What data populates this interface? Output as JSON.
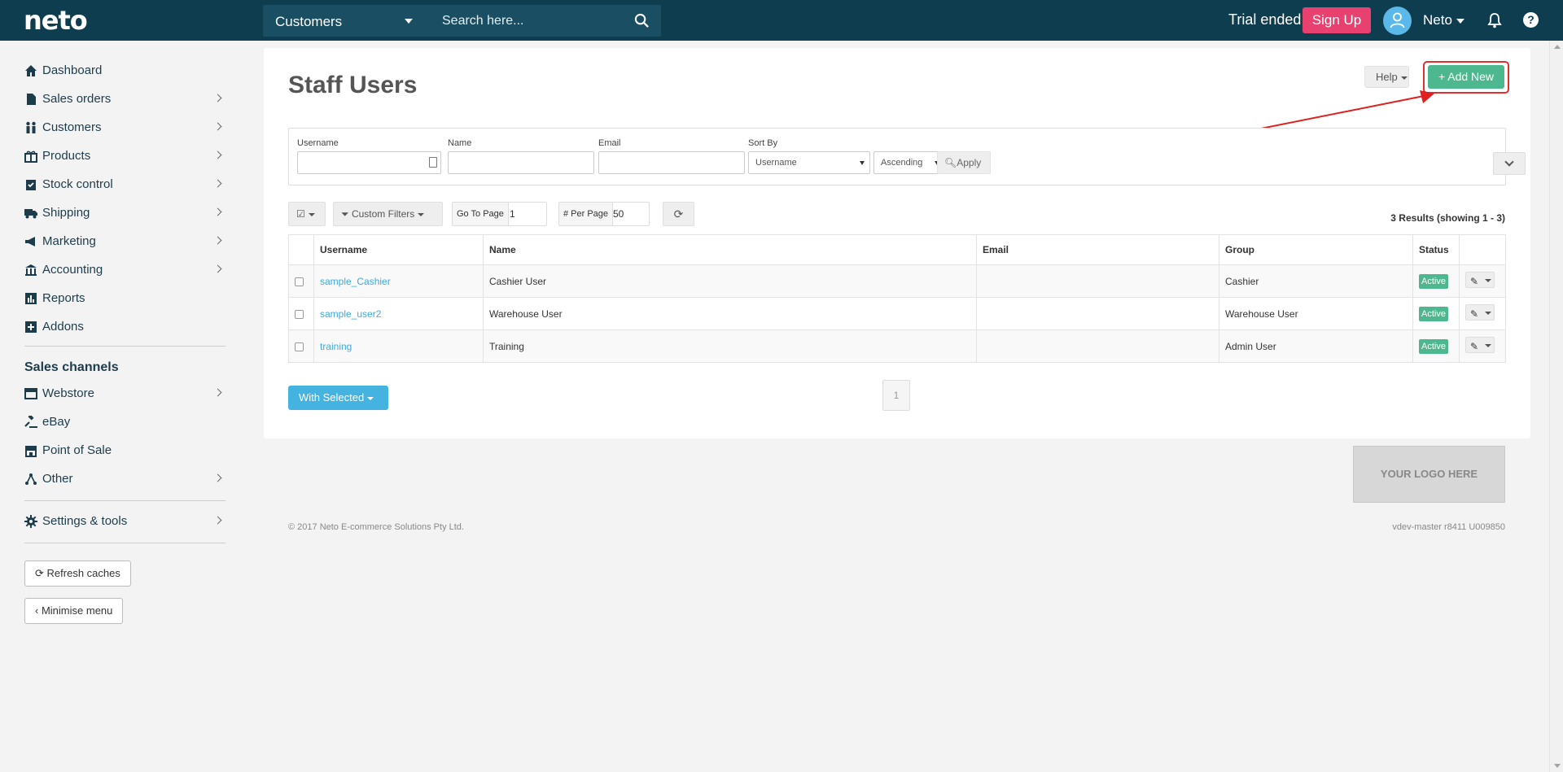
{
  "topbar": {
    "logo": "neto",
    "search_scope": "Customers",
    "search_placeholder": "Search here...",
    "trial_text": "Trial ended.",
    "signup_label": "Sign Up",
    "user_name": "Neto"
  },
  "sidebar": {
    "items": [
      {
        "label": "Dashboard"
      },
      {
        "label": "Sales orders"
      },
      {
        "label": "Customers"
      },
      {
        "label": "Products"
      },
      {
        "label": "Stock control"
      },
      {
        "label": "Shipping"
      },
      {
        "label": "Marketing"
      },
      {
        "label": "Accounting"
      },
      {
        "label": "Reports"
      },
      {
        "label": "Addons"
      }
    ],
    "channels_heading": "Sales channels",
    "channels": [
      {
        "label": "Webstore"
      },
      {
        "label": "eBay"
      },
      {
        "label": "Point of Sale"
      },
      {
        "label": "Other"
      }
    ],
    "settings_label": "Settings & tools",
    "refresh_label": "Refresh caches",
    "minimise_label": "Minimise menu"
  },
  "main": {
    "title": "Staff Users",
    "help_label": "Help",
    "add_new_label": "+ Add New",
    "filters": {
      "username_label": "Username",
      "name_label": "Name",
      "email_label": "Email",
      "sort_by_label": "Sort By",
      "sort_by_value": "Username",
      "order_value": "Ascending",
      "apply_label": "Apply"
    },
    "toolbar": {
      "custom_filters_label": "Custom Filters",
      "go_to_page_label": "Go To Page",
      "go_to_page_value": "1",
      "per_page_label": "# Per Page",
      "per_page_value": "50",
      "results_text": "3 Results (showing 1 - 3)"
    },
    "table": {
      "columns": [
        "Username",
        "Name",
        "Email",
        "Group",
        "Status"
      ],
      "rows": [
        {
          "username": "sample_Cashier",
          "name": "Cashier User",
          "email": "",
          "group": "Cashier",
          "status": "Active"
        },
        {
          "username": "sample_user2",
          "name": "Warehouse User",
          "email": "",
          "group": "Warehouse User",
          "status": "Active"
        },
        {
          "username": "training",
          "name": "Training",
          "email": "",
          "group": "Admin User",
          "status": "Active"
        }
      ]
    },
    "with_selected_label": "With  Selected",
    "page_number": "1"
  },
  "footer": {
    "logo_placeholder": "YOUR LOGO HERE",
    "copyright": "© 2017 Neto E-commerce Solutions Pty Ltd.",
    "version": "vdev-master r8411 U009850"
  },
  "colors": {
    "topbar": "#0f3d50",
    "signup": "#e9416f",
    "add_new": "#4db88f",
    "with_selected": "#44b3e0",
    "link": "#3fa9d8"
  }
}
